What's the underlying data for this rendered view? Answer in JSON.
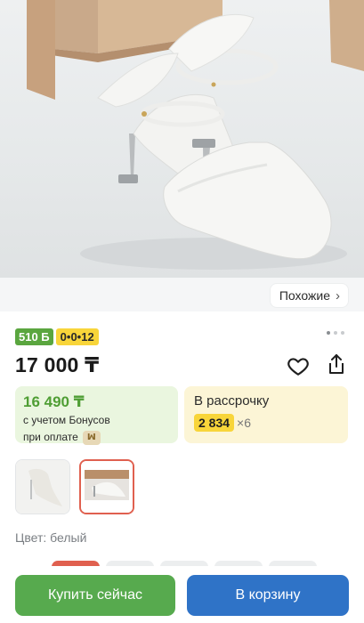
{
  "product": {
    "similar_label": "Похожие",
    "badge_bonus": "510 Б",
    "badge_installment": "0•0•12",
    "price": "17 000 ₸",
    "bonus_card": {
      "amount": "16 490 ₸",
      "line1": "с учетом Бонусов",
      "line2": "при оплате"
    },
    "installment_card": {
      "title": "В рассрочку",
      "amount": "2 834",
      "multiplier": "×6"
    },
    "color_label": "Цвет: белый"
  },
  "gallery": {
    "active_dot": 0,
    "dot_count": 3,
    "selected_thumbnail": 1
  },
  "actions": {
    "buy_now": "Купить сейчас",
    "add_to_cart": "В корзину"
  },
  "icons": {
    "favorite": "heart-icon",
    "share": "share-icon",
    "chevron": "chevron-right-icon",
    "payment": "payment-method-icon"
  },
  "colors": {
    "bonus_green": "#5aa63f",
    "installment_yellow": "#f8d53a",
    "buy_button": "#57aa4e",
    "cart_button": "#2f73c7",
    "selected_accent": "#e0604f"
  }
}
